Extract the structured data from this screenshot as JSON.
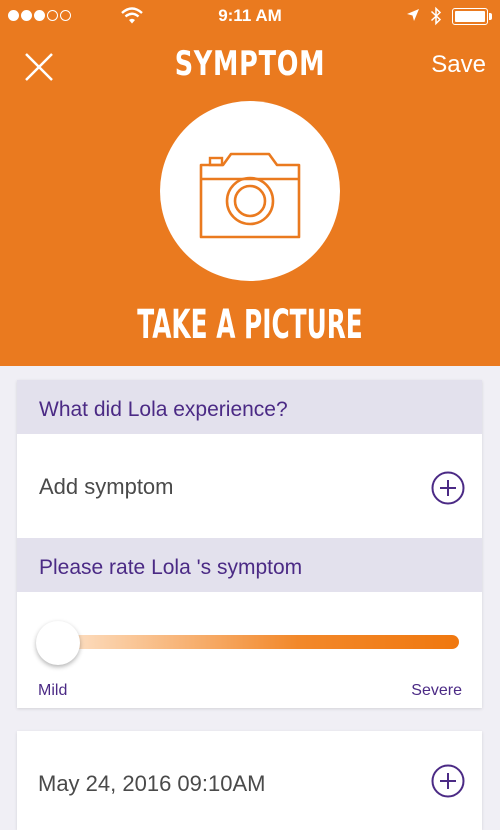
{
  "status_bar": {
    "time": "9:11 AM"
  },
  "header": {
    "close_icon": "close-icon",
    "title": "SYMPTOM",
    "save_label": "Save"
  },
  "photo": {
    "icon": "camera-icon",
    "label": "TAKE A PICTURE"
  },
  "experience": {
    "heading": "What did Lola experience?",
    "add_label": "Add symptom"
  },
  "rating": {
    "heading": "Please rate Lola 's symptom",
    "min_label": "Mild",
    "max_label": "Severe",
    "value": 0
  },
  "date": {
    "value": "May 24, 2016 09:10AM"
  },
  "colors": {
    "accent": "#ea7a1f",
    "purple": "#4b2a85",
    "section_bg": "#e3e1ed"
  }
}
